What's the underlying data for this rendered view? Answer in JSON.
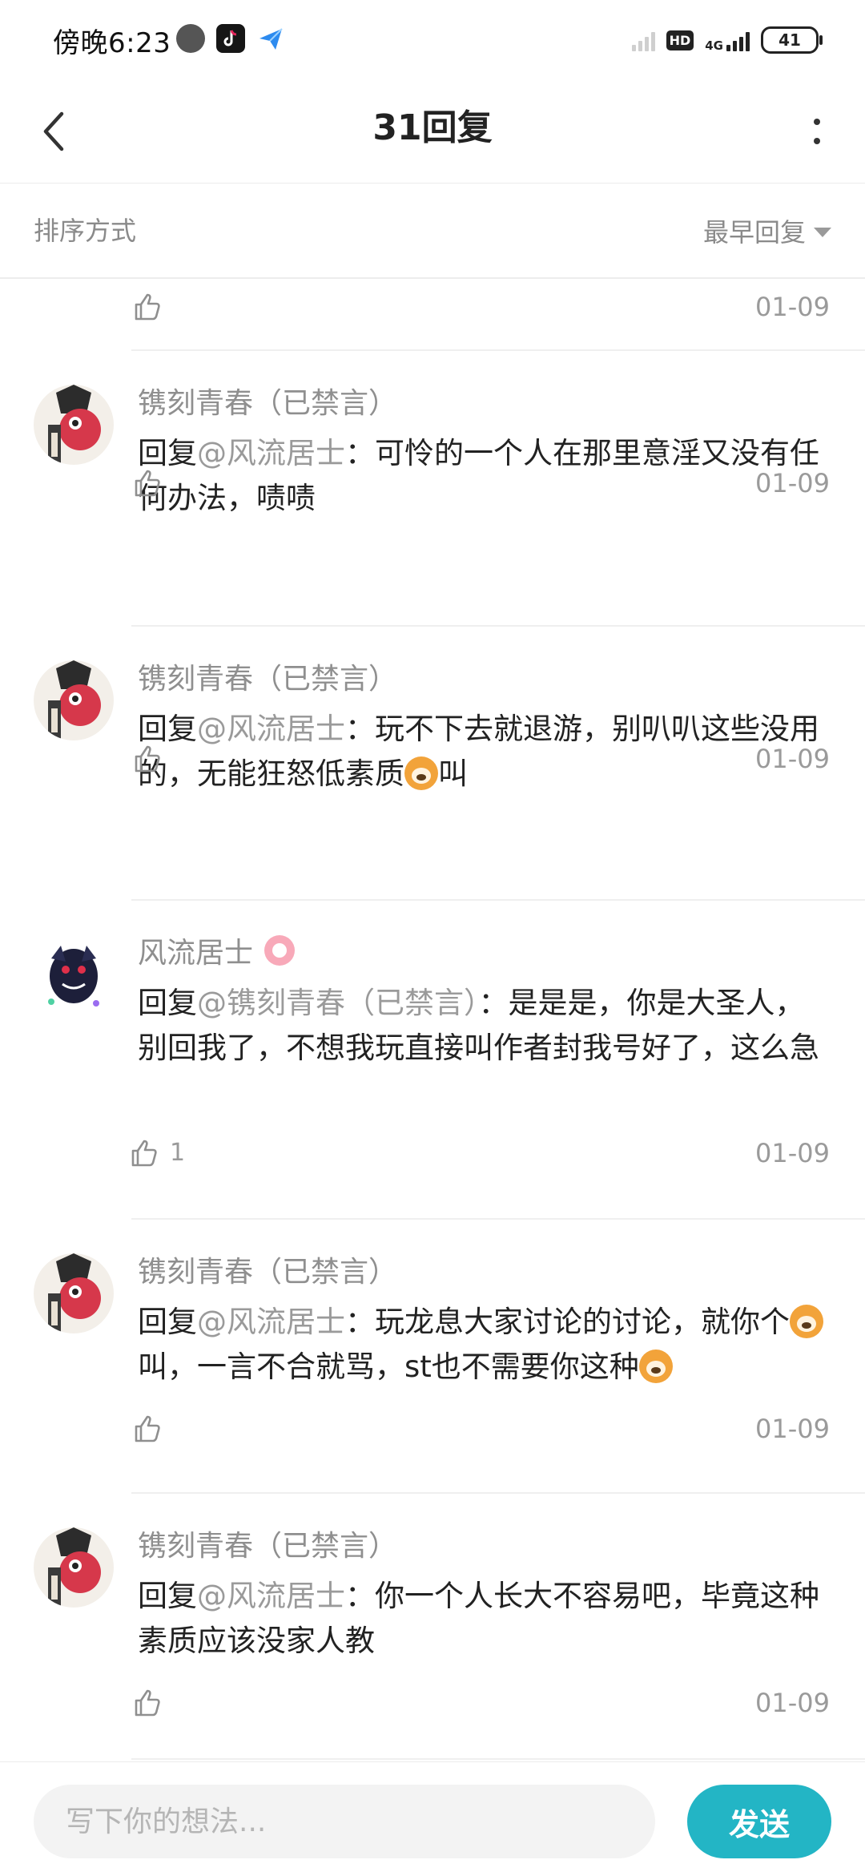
{
  "status_bar": {
    "time": "傍晚6:23",
    "network": "4G",
    "hd": "HD",
    "battery": "41"
  },
  "header": {
    "title": "31回复"
  },
  "sort": {
    "label": "排序方式",
    "selected": "最早回复"
  },
  "partial_row": {
    "date": "01-09"
  },
  "comments": [
    {
      "name": "镌刻青春（已禁言）",
      "prefix": "回复",
      "mention": "@风流居士",
      "sep": "：",
      "text": "可怜的一个人在那里意淫又没有任何办法，啧啧",
      "likes": "",
      "date": "01-09"
    },
    {
      "name": "镌刻青春（已禁言）",
      "prefix": "回复",
      "mention": "@风流居士",
      "sep": "：",
      "text_a": "玩不下去就退游，别叭叭这些没用的，无能狂怒低素质",
      "text_b": "叫",
      "likes": "",
      "date": "01-09"
    },
    {
      "name": "风流居士",
      "prefix": "回复",
      "mention": "@镌刻青春（已禁言）",
      "sep": "：",
      "text": "是是是，你是大圣人，别回我了，不想我玩直接叫作者封我号好了，这么急",
      "likes": "1",
      "date": "01-09"
    },
    {
      "name": "镌刻青春（已禁言）",
      "prefix": "回复",
      "mention": "@风流居士",
      "sep": "：",
      "text_a": "玩龙息大家讨论的讨论，就你个",
      "text_b": "叫，一言不合就骂，st也不需要你这种",
      "likes": "",
      "date": "01-09"
    },
    {
      "name": "镌刻青春（已禁言）",
      "prefix": "回复",
      "mention": "@风流居士",
      "sep": "：",
      "text": "你一个人长大不容易吧，毕竟这种素质应该没家人教",
      "likes": "",
      "date": "01-09"
    }
  ],
  "input": {
    "placeholder": "写下你的想法..."
  },
  "send_label": "发送"
}
